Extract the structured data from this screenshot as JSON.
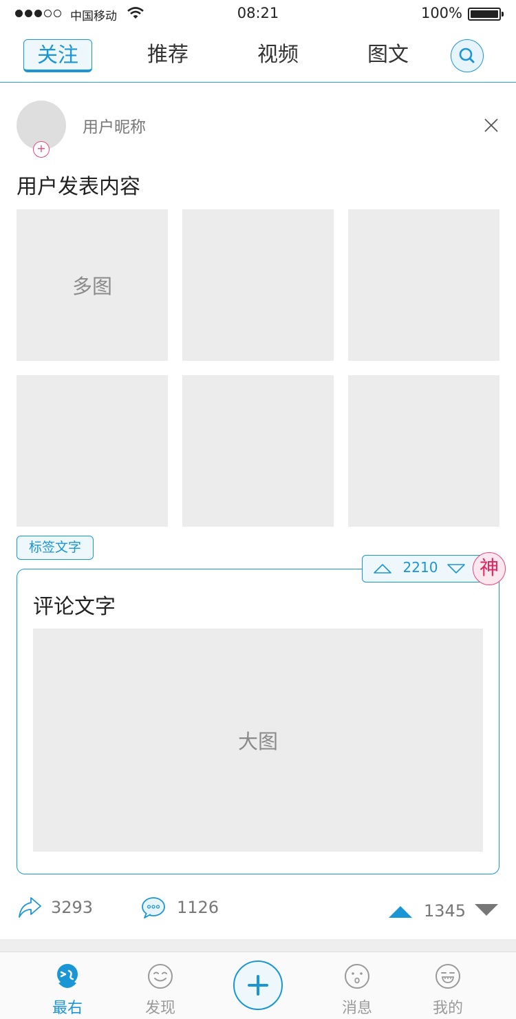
{
  "status_bar": {
    "carrier": "中国移动",
    "time": "08:21",
    "battery": "100%",
    "signal_bars_filled": 3,
    "signal_bars_total": 5
  },
  "top_tabs": [
    {
      "label": "关注",
      "active": true
    },
    {
      "label": "推荐",
      "active": false
    },
    {
      "label": "视频",
      "active": false
    },
    {
      "label": "图文",
      "active": false
    }
  ],
  "icons": {
    "search": "search-icon",
    "close": "close-icon",
    "share": "share-icon",
    "comment": "comment-icon",
    "like": "thumb-up-arrow-icon",
    "dislike": "thumb-down-arrow-icon"
  },
  "post": {
    "nickname": "用户昵称",
    "follow_symbol": "+",
    "content": "用户发表内容",
    "grid_label": "多图",
    "tag": "标签文字"
  },
  "comment": {
    "text": "评论文字",
    "image_label": "大图",
    "votes": "2210",
    "badge": "神"
  },
  "actions": {
    "shares": "3293",
    "comments": "1126",
    "likes": "1345"
  },
  "bottom_nav": [
    {
      "label": "最右",
      "active": true,
      "icon": "logo-icon"
    },
    {
      "label": "发现",
      "active": false,
      "icon": "smile-face-icon"
    },
    {
      "label": "",
      "active": false,
      "icon": "plus-icon"
    },
    {
      "label": "消息",
      "active": false,
      "icon": "surprised-face-icon"
    },
    {
      "label": "我的",
      "active": false,
      "icon": "grin-face-icon"
    }
  ],
  "colors": {
    "accent": "#1a96d4",
    "badge_pink": "#e0245e",
    "placeholder_gray": "#ececec"
  }
}
